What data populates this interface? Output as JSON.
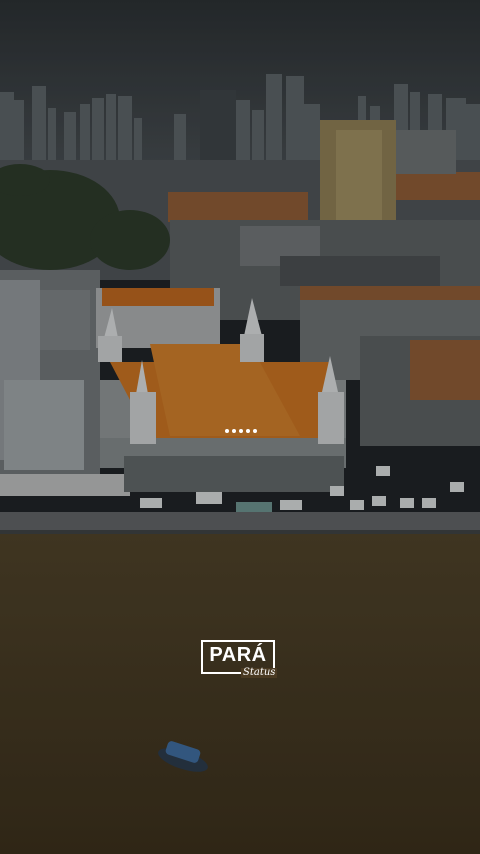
{
  "video": {
    "logo_title": "PARÁ",
    "logo_subtitle": "Status",
    "loading_indicator": "buffering-dots-icon",
    "colors": {
      "sky": "#3b4145",
      "river": "#4a3c25",
      "roof": "#b8651f",
      "text": "#ffffff"
    }
  }
}
